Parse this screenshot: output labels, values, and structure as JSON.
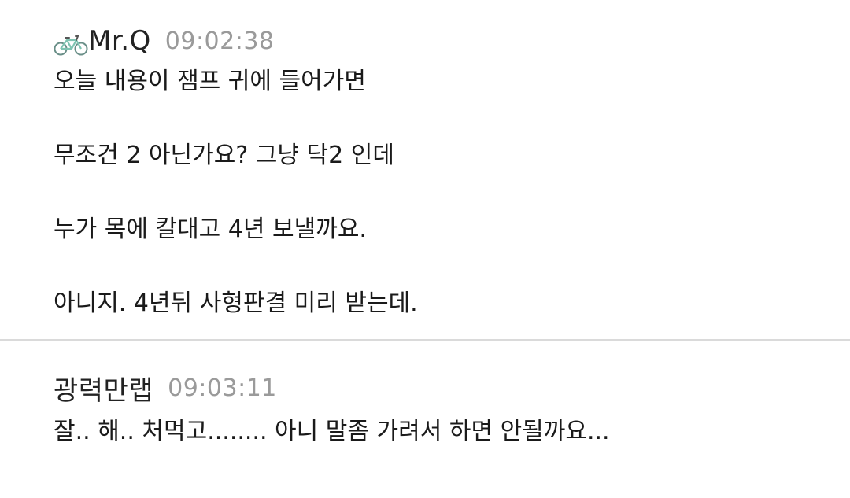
{
  "comments": [
    {
      "author": "Mr.Q",
      "time": "09:02:38",
      "lines": [
        "오늘 내용이 잼프 귀에 들어가면",
        "무조건 2 아닌가요? 그냥 닥2 인데",
        "누가 목에 칼대고 4년 보낼까요.",
        "아니지. 4년뒤 사형판결 미리 받는데."
      ]
    },
    {
      "author": "광력만랩",
      "time": "09:03:11",
      "lines": [
        "잘.. 해.. 처먹고........ 아니 말좀 가려서 하면 안될까요..."
      ]
    }
  ],
  "icons": {
    "author_badge": "bicycle-icon"
  },
  "colors": {
    "timestamp": "#9a9a9a",
    "divider": "#dadada",
    "bicycle": "#7fc4b2"
  }
}
